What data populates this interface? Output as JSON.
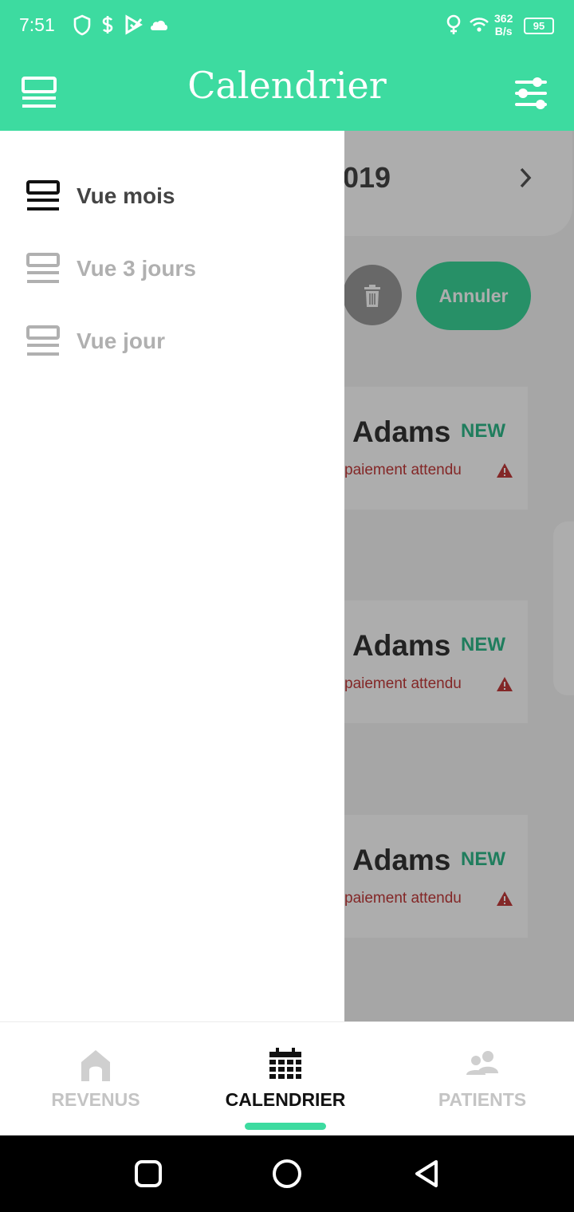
{
  "status_bar": {
    "time": "7:51",
    "net_speed_value": "362",
    "net_speed_unit": "B/s",
    "battery": "95"
  },
  "app_bar": {
    "title": "Calendrier"
  },
  "background": {
    "month_label": "019",
    "cancel_label": "Annuler",
    "appointments": [
      {
        "name": "Adams",
        "badge": "NEW",
        "status": "paiement attendu"
      },
      {
        "name": "Adams",
        "badge": "NEW",
        "status": "paiement attendu"
      },
      {
        "name": "Adams",
        "badge": "NEW",
        "status": "paiement attendu"
      }
    ]
  },
  "drawer": {
    "items": [
      {
        "label": "Vue mois",
        "active": true
      },
      {
        "label": "Vue 3 jours",
        "active": false
      },
      {
        "label": "Vue jour",
        "active": false
      }
    ]
  },
  "bottom_nav": {
    "items": [
      {
        "label": "REVENUS",
        "icon": "home-icon",
        "active": false
      },
      {
        "label": "CALENDRIER",
        "icon": "calendar-icon",
        "active": true
      },
      {
        "label": "PATIENTS",
        "icon": "people-icon",
        "active": false
      }
    ]
  },
  "colors": {
    "accent": "#3ddba0",
    "warning": "#c23a3a",
    "inactive": "#c4c4c4",
    "active_text": "#111111"
  }
}
